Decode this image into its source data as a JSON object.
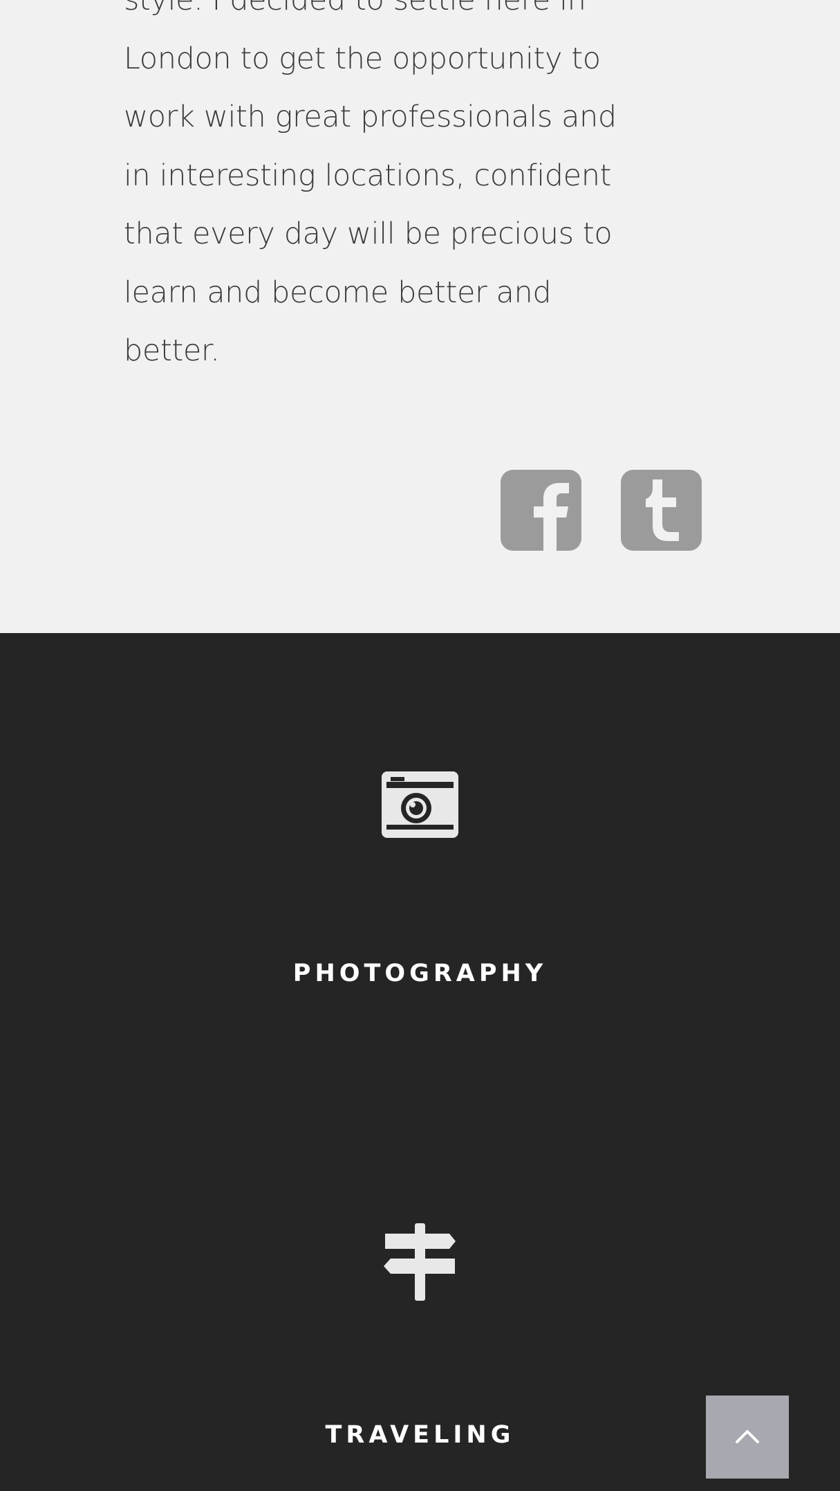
{
  "about": {
    "bio_lines": [
      "style. I decided to settle here in",
      "London to get the opportunity to",
      "work with great professionals and",
      "in interesting locations, confident",
      "that every day will be precious to",
      "learn and become better and",
      "better."
    ],
    "social": [
      {
        "icon": "facebook-icon"
      },
      {
        "icon": "tumblr-icon"
      }
    ]
  },
  "skills": [
    {
      "icon": "camera-icon",
      "title": "PHOTOGRAPHY"
    },
    {
      "icon": "signpost-icon",
      "title": "TRAVELING"
    }
  ],
  "scroll_top": {
    "icon": "chevron-up-icon"
  },
  "colors": {
    "about_bg": "#f1f1f1",
    "skills_bg": "#252525",
    "social_icon": "#9b9b9b",
    "skill_icon": "#e8e8e8",
    "scroll_top_bg": "#a8a9b0"
  }
}
